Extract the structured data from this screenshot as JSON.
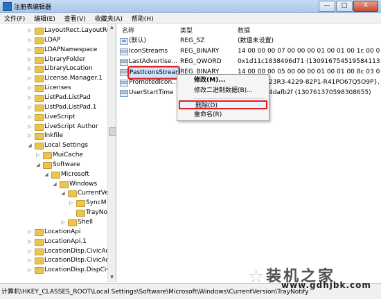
{
  "window": {
    "title": "注册表编辑器"
  },
  "window_buttons": {
    "minimize": "—",
    "maximize": "□",
    "close": "X"
  },
  "menu": [
    "文件(F)",
    "编辑(E)",
    "查看(V)",
    "收藏夹(A)",
    "帮助(H)"
  ],
  "tree": [
    {
      "label": "LayoutRect.LayoutRect.",
      "indent": 0,
      "arrow": "▷"
    },
    {
      "label": "LDAP",
      "indent": 0,
      "arrow": "▷"
    },
    {
      "label": "LDAPNamespace",
      "indent": 0,
      "arrow": "▷"
    },
    {
      "label": "LibraryFolder",
      "indent": 0,
      "arrow": "▷"
    },
    {
      "label": "LibraryLocation",
      "indent": 0,
      "arrow": "▷"
    },
    {
      "label": "License.Manager.1",
      "indent": 0,
      "arrow": "▷"
    },
    {
      "label": "Licenses",
      "indent": 0,
      "arrow": "▷"
    },
    {
      "label": "ListPad.ListPad",
      "indent": 0,
      "arrow": "▷"
    },
    {
      "label": "ListPad.ListPad.1",
      "indent": 0,
      "arrow": "▷"
    },
    {
      "label": "LiveScript",
      "indent": 0,
      "arrow": "▷"
    },
    {
      "label": "LiveScript Author",
      "indent": 0,
      "arrow": "▷"
    },
    {
      "label": "lnkfile",
      "indent": 0,
      "arrow": "▷"
    },
    {
      "label": "Local Settings",
      "indent": 0,
      "arrow": "◢"
    },
    {
      "label": "MuiCache",
      "indent": 1,
      "arrow": "▷"
    },
    {
      "label": "Software",
      "indent": 1,
      "arrow": "◢"
    },
    {
      "label": "Microsoft",
      "indent": 2,
      "arrow": "◢"
    },
    {
      "label": "Windows",
      "indent": 3,
      "arrow": "◢"
    },
    {
      "label": "CurrentVe",
      "indent": 4,
      "arrow": "◢"
    },
    {
      "label": "SyncM",
      "indent": 5,
      "arrow": "▷"
    },
    {
      "label": "TrayNo",
      "indent": 5,
      "arrow": ""
    },
    {
      "label": "Shell",
      "indent": 4,
      "arrow": "▷"
    },
    {
      "label": "LocationApi",
      "indent": 0,
      "arrow": "▷"
    },
    {
      "label": "LocationApi.1",
      "indent": 0,
      "arrow": "▷"
    },
    {
      "label": "LocationDisp.CivicAddr",
      "indent": 0,
      "arrow": "▷"
    },
    {
      "label": "LocationDisp.CivicAddr",
      "indent": 0,
      "arrow": "▷"
    },
    {
      "label": "LocationDisp.DispCivic",
      "indent": 0,
      "arrow": "▷"
    }
  ],
  "columns": {
    "name": "名称",
    "type": "类型",
    "data": "数据"
  },
  "values": [
    {
      "icon": "ab",
      "name": "(默认)",
      "type": "REG_SZ",
      "data": "(数值未设置)"
    },
    {
      "icon": "010",
      "name": "IconStreams",
      "type": "REG_BINARY",
      "data": "14 00 00 00 07 00 00 00 01 00 01 00 1c 00 00..."
    },
    {
      "icon": "010",
      "name": "LastAdvertise...",
      "type": "REG_QWORD",
      "data": "0x1d11c1838496d71 (130916754519584113)"
    },
    {
      "icon": "010",
      "name": "PastIconsStream",
      "type": "REG_BINARY",
      "data": "14 00 00 00 05 00 00 00 01 00 01 00 8c 03 00..."
    },
    {
      "icon": "010",
      "name": "PromotedIcon...",
      "type": "",
      "data": "23R3-4229-82P1-R41PO67Q5O9P}..."
    },
    {
      "icon": "010",
      "name": "UserStartTime",
      "type": "",
      "data": "4dafb2f (130761370598308655)"
    }
  ],
  "context_menu": [
    {
      "label": "修改(M)...",
      "bold": true
    },
    {
      "label": "修改二进制数据(B)...",
      "bold": false
    },
    {
      "label": "删除(D)",
      "bold": false
    },
    {
      "label": "重命名(R)",
      "bold": false
    }
  ],
  "status": "计算机\\HKEY_CLASSES_ROOT\\Local Settings\\Software\\Microsoft\\Windows\\CurrentVersion\\TrayNotify",
  "watermark": {
    "title": "装机之家",
    "url": "www.gdhjbk.com"
  }
}
